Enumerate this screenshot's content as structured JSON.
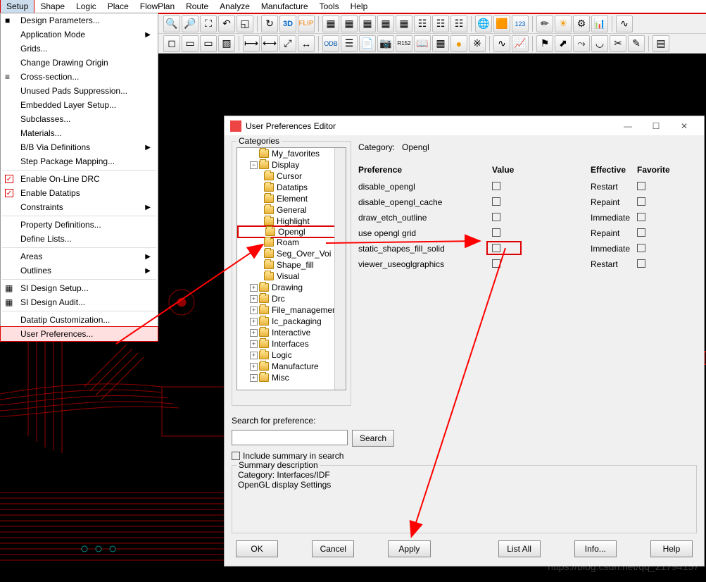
{
  "menubar": [
    "Setup",
    "Shape",
    "Logic",
    "Place",
    "FlowPlan",
    "Route",
    "Analyze",
    "Manufacture",
    "Tools",
    "Help"
  ],
  "dropdown": {
    "items": [
      {
        "label": "Design Parameters...",
        "icon": "■"
      },
      {
        "label": "Application Mode",
        "sub": true
      },
      {
        "label": "Grids..."
      },
      {
        "label": "Change Drawing Origin"
      },
      {
        "label": "Cross-section...",
        "icon": "≡"
      },
      {
        "label": "Unused Pads Suppression..."
      },
      {
        "label": "Embedded Layer Setup..."
      },
      {
        "label": "Subclasses..."
      },
      {
        "label": "Materials..."
      },
      {
        "label": "B/B Via Definitions",
        "sub": true
      },
      {
        "label": "Step Package Mapping..."
      },
      {
        "sep": true
      },
      {
        "label": "Enable On-Line DRC",
        "check": true
      },
      {
        "label": "Enable Datatips",
        "check": true
      },
      {
        "label": "Constraints",
        "sub": true
      },
      {
        "sep": true
      },
      {
        "label": "Property Definitions..."
      },
      {
        "label": "Define Lists..."
      },
      {
        "sep": true
      },
      {
        "label": "Areas",
        "sub": true
      },
      {
        "label": "Outlines",
        "sub": true
      },
      {
        "sep": true
      },
      {
        "label": "SI Design Setup...",
        "icon": "▦"
      },
      {
        "label": "SI Design Audit...",
        "icon": "▦"
      },
      {
        "sep": true
      },
      {
        "label": "Datatip Customization..."
      },
      {
        "label": "User Preferences...",
        "highlight": true
      }
    ]
  },
  "dialog": {
    "title": "User Preferences Editor",
    "categories_label": "Categories",
    "category_label": "Category:",
    "category_value": "Opengl",
    "tree_l1": "My_favorites",
    "tree_disp": "Display",
    "tree_disp_children": [
      "Cursor",
      "Datatips",
      "Element",
      "General",
      "Highlight",
      "Opengl",
      "Roam",
      "Seg_Over_Voi",
      "Shape_fill",
      "Visual"
    ],
    "tree_rest": [
      "Drawing",
      "Drc",
      "File_management",
      "Ic_packaging",
      "Interactive",
      "Interfaces",
      "Logic",
      "Manufacture",
      "Misc"
    ],
    "search_label": "Search for preference:",
    "search_btn": "Search",
    "include_label": "Include summary in search",
    "headers": {
      "pref": "Preference",
      "val": "Value",
      "eff": "Effective",
      "fav": "Favorite"
    },
    "rows": [
      {
        "p": "disable_opengl",
        "e": "Restart"
      },
      {
        "p": "disable_opengl_cache",
        "e": "Repaint"
      },
      {
        "p": "draw_etch_outline",
        "e": "Immediate"
      },
      {
        "p": "use opengl grid",
        "e": "Repaint"
      },
      {
        "p": "static_shapes_fill_solid",
        "e": "Immediate",
        "hl": true
      },
      {
        "p": "viewer_useoglgraphics",
        "e": "Restart"
      }
    ],
    "summary_title": "Summary description",
    "summary_l1": "Category: Interfaces/IDF",
    "summary_l2": "OpenGL display Settings",
    "buttons": {
      "ok": "OK",
      "cancel": "Cancel",
      "apply": "Apply",
      "listall": "List All",
      "info": "Info...",
      "help": "Help"
    }
  },
  "watermark": "https://blog.csdn.net/qq_21794157"
}
